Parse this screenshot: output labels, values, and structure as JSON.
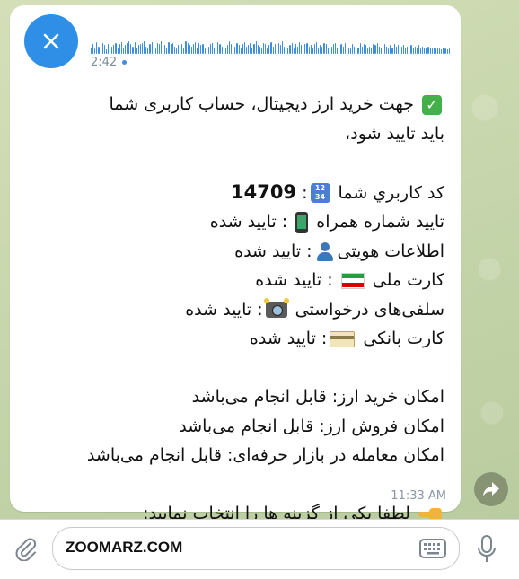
{
  "voice_message": {
    "duration": "2:42",
    "waveform": [
      6,
      9,
      5,
      11,
      7,
      6,
      10,
      8,
      4,
      9,
      12,
      7,
      8,
      10,
      6,
      9,
      11,
      5,
      8,
      10,
      12,
      9,
      7,
      11,
      6,
      8,
      9,
      10,
      12,
      7,
      6,
      9,
      11,
      8,
      5,
      10,
      9,
      12,
      7,
      8,
      6,
      11,
      9,
      10,
      7,
      5,
      8,
      11,
      9,
      6,
      12,
      10,
      8,
      7,
      9,
      11,
      6,
      10,
      8,
      9,
      5,
      12,
      7,
      9,
      10,
      6,
      8,
      11,
      9,
      7,
      10,
      6,
      8,
      12,
      9,
      5,
      7,
      10,
      8,
      6,
      9,
      11,
      7,
      8,
      10,
      6,
      9,
      12,
      8,
      7,
      6,
      10,
      9,
      5,
      8,
      11,
      7,
      9,
      6,
      10,
      8,
      12,
      7,
      9,
      6,
      8,
      10,
      5,
      9,
      7,
      11,
      8,
      6,
      9,
      10,
      7,
      8,
      6,
      9,
      11,
      5,
      8,
      7,
      10,
      9,
      6,
      8,
      7,
      9,
      10,
      6,
      8,
      9,
      7,
      10,
      8,
      6,
      5,
      9,
      7,
      8,
      6,
      10,
      7,
      9,
      8,
      5,
      7,
      6,
      9,
      8,
      10,
      7,
      6,
      8,
      9,
      7,
      5,
      8,
      6,
      9,
      7,
      8,
      6,
      7,
      8,
      6,
      7,
      5,
      8,
      6,
      7,
      6,
      8,
      5,
      7,
      6,
      5,
      7,
      6,
      5,
      6,
      5,
      6,
      5,
      4,
      6,
      5,
      4,
      5
    ]
  },
  "message": {
    "line1_text": "جهت خرید ارز دیجیتال، حساب کاربری شما",
    "line2_text": "باید تایید شود،",
    "user_id_label": "کد کاربري شما",
    "user_id_value": "14709",
    "phone_label": "تایید شماره همراه",
    "phone_status": ": تایید شده",
    "identity_label": "اطلاعات هویتی",
    "identity_status": ": تایید شده",
    "national_card_label": "کارت ملی",
    "national_card_status": ": تایید شده",
    "selfie_label": "سلفی‌های درخواستی",
    "selfie_status": ": تایید شده",
    "bank_card_label": "کارت بانکی",
    "bank_card_status": ": تایید شده",
    "buy_text": "امکان خرید ارز: قابل انجام می‌باشد",
    "sell_text": "امکان فروش ارز: قابل انجام می‌باشد",
    "pro_trade_text": "امکان معامله در بازار حرفه‌ای: قابل انجام می‌باشد",
    "choose_text": "لطفا یکی از گزینه ها را انتخاب نمایید:",
    "time": "11:33 AM"
  },
  "input_bar": {
    "text_value": "ZOOMARZ.COM"
  },
  "colors": {
    "accent": "#2f8fe6",
    "bubble": "#ffffff",
    "time": "#8a96a3"
  }
}
